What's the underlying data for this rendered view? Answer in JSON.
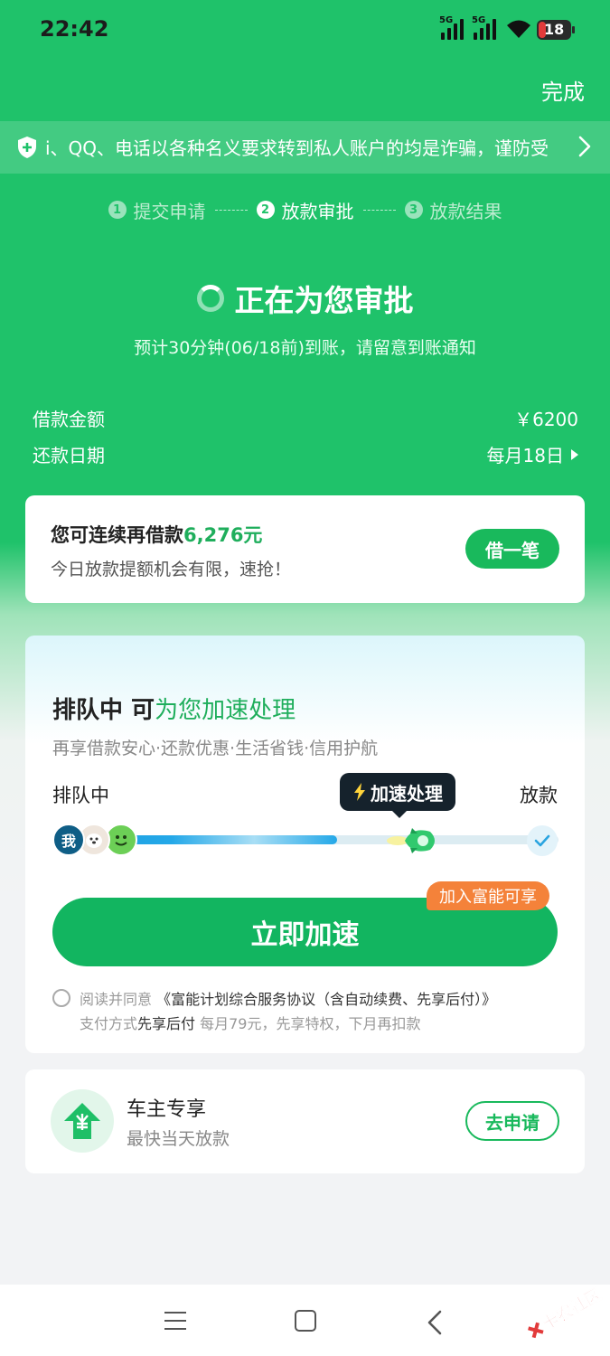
{
  "status_bar": {
    "time": "22:42",
    "signal1": "5G",
    "signal2": "5G",
    "battery": "18"
  },
  "header": {
    "done_label": "完成"
  },
  "notice": {
    "text": "i、QQ、电话以各种名义要求转到私人账户的均是诈骗，谨防受",
    "icons": [
      "shield-icon",
      "chevron-right-icon"
    ]
  },
  "steps": [
    {
      "num": "1",
      "label": "提交申请"
    },
    {
      "num": "2",
      "label": "放款审批"
    },
    {
      "num": "3",
      "label": "放款结果"
    }
  ],
  "status": {
    "title": "正在为您审批",
    "subtitle": "预计30分钟(06/18前)到账，请留意到账通知"
  },
  "loan": {
    "amount_label": "借款金额",
    "amount_value": "￥6200",
    "date_label": "还款日期",
    "date_value": "每月18日"
  },
  "reborrow": {
    "prefix": "您可连续再借款",
    "amount": "6,276元",
    "note": "今日放款提额机会有限，速抢！",
    "button": "借一笔"
  },
  "accelerate": {
    "heading_prefix": "排队中 可",
    "heading_green": "为您加速处理",
    "subtitle": "再享借款安心·还款优惠·生活省钱·信用护航",
    "queue_label": "排队中",
    "speed_label": "加速处理",
    "release_label": "放款",
    "avatar_me": "我",
    "badge": "加入富能可享",
    "button": "立即加速",
    "agree_prefix": "阅读并同意",
    "agreement": "《富能计划综合服务协议（含自动续费、先享后付）》",
    "pay_prefix": "支付方式",
    "pay_method": "先享后付",
    "pay_detail": " 每月79元，先享特权，下月再扣款"
  },
  "car_owner": {
    "title": "车主专享",
    "subtitle": "最快当天放款",
    "button": "去申请"
  },
  "watermark": "卡农社区",
  "colors": {
    "brand_green": "#1fc26a",
    "button_green": "#12b560",
    "badge_orange": "#f4823a"
  }
}
